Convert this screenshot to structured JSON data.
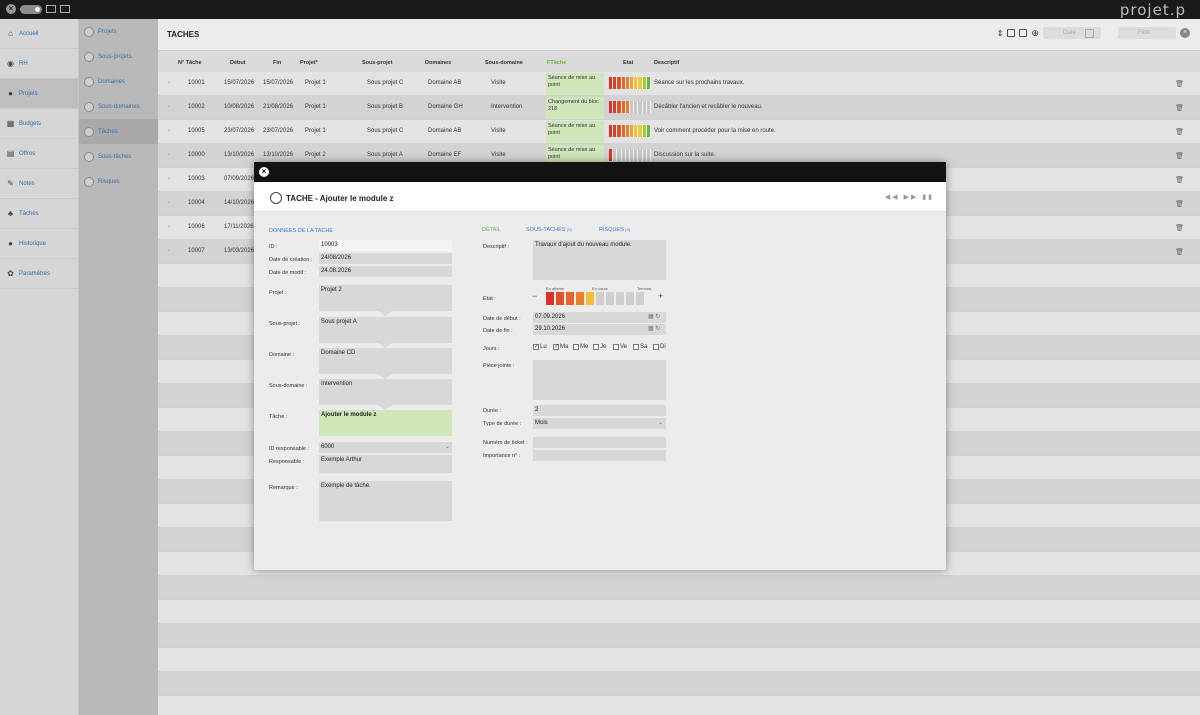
{
  "brand": "projet.p",
  "nav": [
    {
      "label": "Accueil",
      "icon": "home-icon",
      "glyph": "⌂"
    },
    {
      "label": "RH",
      "icon": "user-icon",
      "glyph": "◉"
    },
    {
      "label": "Projets",
      "icon": "globe-icon",
      "glyph": "●"
    },
    {
      "label": "Budgets",
      "icon": "calculator-icon",
      "glyph": "▦"
    },
    {
      "label": "Offres",
      "icon": "grid-icon",
      "glyph": "▤"
    },
    {
      "label": "Notes",
      "icon": "pen-icon",
      "glyph": "✎"
    },
    {
      "label": "Tâches",
      "icon": "tasks-icon",
      "glyph": "♣"
    },
    {
      "label": "Historique",
      "icon": "history-icon",
      "glyph": "●"
    },
    {
      "label": "Paramètres",
      "icon": "gear-icon",
      "glyph": "✿"
    }
  ],
  "subnav": [
    "Projets",
    "Sous-projets",
    "Domaines",
    "Sous-domaines",
    "Tâches",
    "Sous-tâches",
    "Risques"
  ],
  "main": {
    "title": "TACHES",
    "date_start_placeholder": "Date",
    "date_end_placeholder": "Fitre"
  },
  "columns": [
    "N° Tâche",
    "Début",
    "Fin",
    "Projet*",
    "Sous-projet",
    "Domaines",
    "Sous-domaine",
    "FTâche",
    "Etat",
    "Descriptif"
  ],
  "rows": [
    {
      "id": "10001",
      "start": "15/07/2026",
      "end": "15/07/2026",
      "project": "Projet 1",
      "subproject": "Sous projet C",
      "domain": "Domaine AB",
      "subdomain": "Visite",
      "task": "Séance de mise au point",
      "state": 10,
      "desc": "Séance sur les prochains travaux."
    },
    {
      "id": "10002",
      "start": "10/08/2026",
      "end": "21/08/2026",
      "project": "Projet 1",
      "subproject": "Sous projet B",
      "domain": "Domaine GH",
      "subdomain": "Intervention",
      "task": "Changement du bloc 218",
      "state": 5,
      "desc": "Décâbler l'ancien et recâbler le nouveau."
    },
    {
      "id": "10005",
      "start": "23/07/2026",
      "end": "23/07/2026",
      "project": "Projet 1",
      "subproject": "Sous projet C",
      "domain": "Domaine AB",
      "subdomain": "Visite",
      "task": "Séance de mise au point",
      "state": 10,
      "desc": "Voir comment procéder pour la mise en route."
    },
    {
      "id": "10000",
      "start": "13/10/2026",
      "end": "13/10/2026",
      "project": "Projet 2",
      "subproject": "Sous projet A",
      "domain": "Domaine EF",
      "subdomain": "Visite",
      "task": "Séance de mise au point",
      "state": 1,
      "desc": "Discussion sur la suite."
    },
    {
      "id": "10003",
      "start": "07/09/2026",
      "end": "",
      "project": "",
      "subproject": "",
      "domain": "",
      "subdomain": "",
      "task": "",
      "state": 0,
      "desc": ""
    },
    {
      "id": "10004",
      "start": "14/10/2026",
      "end": "",
      "project": "",
      "subproject": "",
      "domain": "",
      "subdomain": "",
      "task": "",
      "state": 0,
      "desc": ""
    },
    {
      "id": "10006",
      "start": "17/11/2026",
      "end": "",
      "project": "",
      "subproject": "",
      "domain": "",
      "subdomain": "",
      "task": "",
      "state": 0,
      "desc": ""
    },
    {
      "id": "10007",
      "start": "13/03/2026",
      "end": "",
      "project": "",
      "subproject": "",
      "domain": "",
      "subdomain": "",
      "task": "",
      "state": 0,
      "desc": ""
    }
  ],
  "state_colors": [
    "#d8322a",
    "#dc3d2a",
    "#e0522a",
    "#e3672b",
    "#e97f2d",
    "#efa032",
    "#f1be39",
    "#e0d040",
    "#a4c93f",
    "#6cb33f"
  ],
  "modal": {
    "title": "TACHE - Ajouter le module z",
    "sec_left": "DONNEES DE LA TACHE",
    "tab_detail": "DÉTAIL",
    "tab_subtasks": "SOUS-TACHES",
    "tab_subtasks_count": "(0)",
    "tab_risks": "RISQUES",
    "tab_risks_count": "(0)",
    "labels": {
      "id": "ID :",
      "created": "Date de création :",
      "modified": "Date de modif :",
      "project": "Projet :",
      "subproject": "Sous-projet :",
      "domain": "Domaine :",
      "subdomain": "Sous-domaine :",
      "task": "Tâche :",
      "resp_id": "ID responsable :",
      "resp": "Responsable :",
      "remark": "Remarque :",
      "desc": "Descriptif :",
      "state": "Etat :",
      "date_start": "Date de début :",
      "date_end": "Date de fin :",
      "days": "Jours :",
      "attachment": "Pièce jointe :",
      "duration": "Durée :",
      "duration_type": "Type de durée :",
      "ticket": "Numéro de ticket :",
      "importance": "Importance n° :"
    },
    "values": {
      "id": "10003",
      "created": "24/08/2026",
      "modified": "24.08.2026",
      "project": "Projet 2",
      "subproject": "Sous projet A",
      "domain": "Domaine CD",
      "subdomain": "Intervention",
      "task": "Ajouter le module z",
      "resp_id": "6000",
      "resp": "Exemple Arthur",
      "remark": "Exemple de tâche.",
      "desc": "Travaux d'ajout du nouveau module.",
      "date_start": "07.09.2026",
      "date_end": "29.10.2026",
      "duration": "2",
      "duration_type": "Mois",
      "ticket": "",
      "importance": ""
    },
    "state_legend": {
      "waiting": "En attente",
      "progress": "En cours",
      "done": "Terminé"
    },
    "state_level": 5,
    "days": [
      {
        "label": "Lu",
        "checked": true
      },
      {
        "label": "Ma",
        "checked": true
      },
      {
        "label": "Me",
        "checked": false
      },
      {
        "label": "Je",
        "checked": false
      },
      {
        "label": "Ve",
        "checked": false
      },
      {
        "label": "Sa",
        "checked": false
      },
      {
        "label": "Di",
        "checked": false
      }
    ]
  }
}
